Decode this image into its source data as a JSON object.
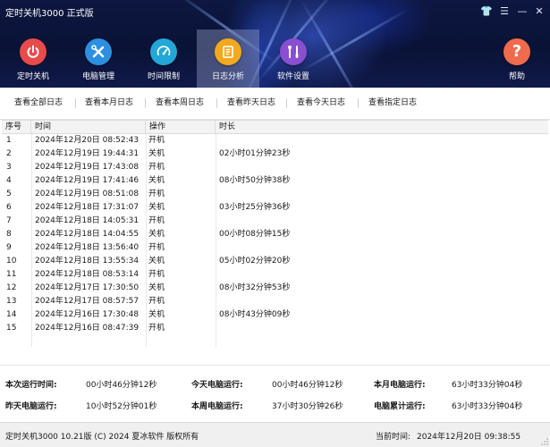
{
  "app": {
    "title": "定时关机3000 正式版",
    "window_controls": {
      "skin": "👕",
      "menu": "☰",
      "minimize": "—",
      "close": "✕"
    }
  },
  "nav": {
    "items": [
      {
        "label": "定时关机",
        "icon": "power-icon",
        "color": "#e84b4b"
      },
      {
        "label": "电脑管理",
        "icon": "tools-icon",
        "color": "#2d8fe0"
      },
      {
        "label": "时间限制",
        "icon": "speedometer-icon",
        "color": "#22a7d8"
      },
      {
        "label": "日志分析",
        "icon": "document-icon",
        "color": "#f2a91f",
        "active": true
      },
      {
        "label": "软件设置",
        "icon": "wrench-screwdriver-icon",
        "color": "#8a4fd0"
      }
    ],
    "help": {
      "label": "帮助",
      "icon": "question-icon",
      "color": "#ee6b4d"
    }
  },
  "toolbar": {
    "buttons": [
      "查看全部日志",
      "查看本月日志",
      "查看本周日志",
      "查看昨天日志",
      "查看今天日志",
      "查看指定日志"
    ]
  },
  "table": {
    "columns": [
      "序号",
      "时间",
      "操作",
      "时长"
    ],
    "rows": [
      {
        "no": "1",
        "time": "2024年12月20日 08:52:43",
        "op": "开机",
        "dur": ""
      },
      {
        "no": "2",
        "time": "2024年12月19日 19:44:31",
        "op": "关机",
        "dur": "02小时01分钟23秒"
      },
      {
        "no": "3",
        "time": "2024年12月19日 17:43:08",
        "op": "开机",
        "dur": ""
      },
      {
        "no": "4",
        "time": "2024年12月19日 17:41:46",
        "op": "关机",
        "dur": "08小时50分钟38秒"
      },
      {
        "no": "5",
        "time": "2024年12月19日 08:51:08",
        "op": "开机",
        "dur": ""
      },
      {
        "no": "6",
        "time": "2024年12月18日 17:31:07",
        "op": "关机",
        "dur": "03小时25分钟36秒"
      },
      {
        "no": "7",
        "time": "2024年12月18日 14:05:31",
        "op": "开机",
        "dur": ""
      },
      {
        "no": "8",
        "time": "2024年12月18日 14:04:55",
        "op": "关机",
        "dur": "00小时08分钟15秒"
      },
      {
        "no": "9",
        "time": "2024年12月18日 13:56:40",
        "op": "开机",
        "dur": ""
      },
      {
        "no": "10",
        "time": "2024年12月18日 13:55:34",
        "op": "关机",
        "dur": "05小时02分钟20秒"
      },
      {
        "no": "11",
        "time": "2024年12月18日 08:53:14",
        "op": "开机",
        "dur": ""
      },
      {
        "no": "12",
        "time": "2024年12月17日 17:30:50",
        "op": "关机",
        "dur": "08小时32分钟53秒"
      },
      {
        "no": "13",
        "time": "2024年12月17日 08:57:57",
        "op": "开机",
        "dur": ""
      },
      {
        "no": "14",
        "time": "2024年12月16日 17:30:48",
        "op": "关机",
        "dur": "08小时43分钟09秒"
      },
      {
        "no": "15",
        "time": "2024年12月16日 08:47:39",
        "op": "开机",
        "dur": ""
      }
    ]
  },
  "stats": [
    {
      "label": "本次运行时间:",
      "value": "00小时46分钟12秒"
    },
    {
      "label": "今天电脑运行:",
      "value": "00小时46分钟12秒"
    },
    {
      "label": "本月电脑运行:",
      "value": "63小时33分钟04秒"
    },
    {
      "label": "昨天电脑运行:",
      "value": "10小时52分钟01秒"
    },
    {
      "label": "本周电脑运行:",
      "value": "37小时30分钟26秒"
    },
    {
      "label": "电脑累计运行:",
      "value": "63小时33分钟04秒"
    }
  ],
  "statusbar": {
    "copyright": "定时关机3000  10.21版  (C)  2024  夏冰软件  版权所有",
    "time_label": "当前时间:",
    "time_value": "2024年12月20日  09:38:55"
  }
}
